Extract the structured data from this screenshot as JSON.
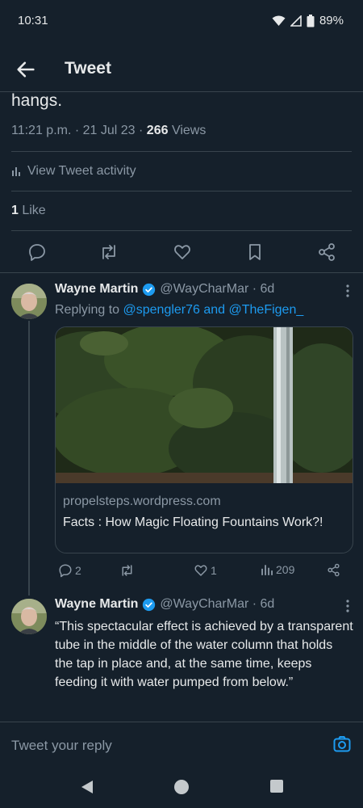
{
  "status_bar": {
    "time": "10:31",
    "battery": "89%"
  },
  "header": {
    "title": "Tweet"
  },
  "main_tweet": {
    "text_tail": "hangs.",
    "timestamp": "11:21 p.m. · 21 Jul 23 · ",
    "views_count": "266",
    "views_label": " Views",
    "activity_label": "View Tweet activity",
    "likes_count": "1",
    "likes_label": " Like"
  },
  "reply1": {
    "name": "Wayne Martin",
    "handle": "@WayCharMar · 6d",
    "replying_prefix": "Replying to ",
    "replying_users": "@spengler76 and @TheFigen_",
    "link_card": {
      "domain": "propelsteps.wordpress.com",
      "title": "Facts : How Magic Floating Fountains Work?!"
    },
    "replies": "2",
    "likes": "1",
    "views": "209"
  },
  "reply2": {
    "name": "Wayne Martin",
    "handle": "@WayCharMar · 6d",
    "text": "“This spectacular effect is achieved by a transparent tube in the middle of the water column that holds the tap in place and, at the same time, keeps feeding it with water pumped from below.”"
  },
  "composer": {
    "placeholder": "Tweet your reply"
  },
  "colors": {
    "background": "#15202b",
    "accent": "#1d9bf0",
    "muted": "#8b98a5",
    "divider": "#38444d"
  }
}
